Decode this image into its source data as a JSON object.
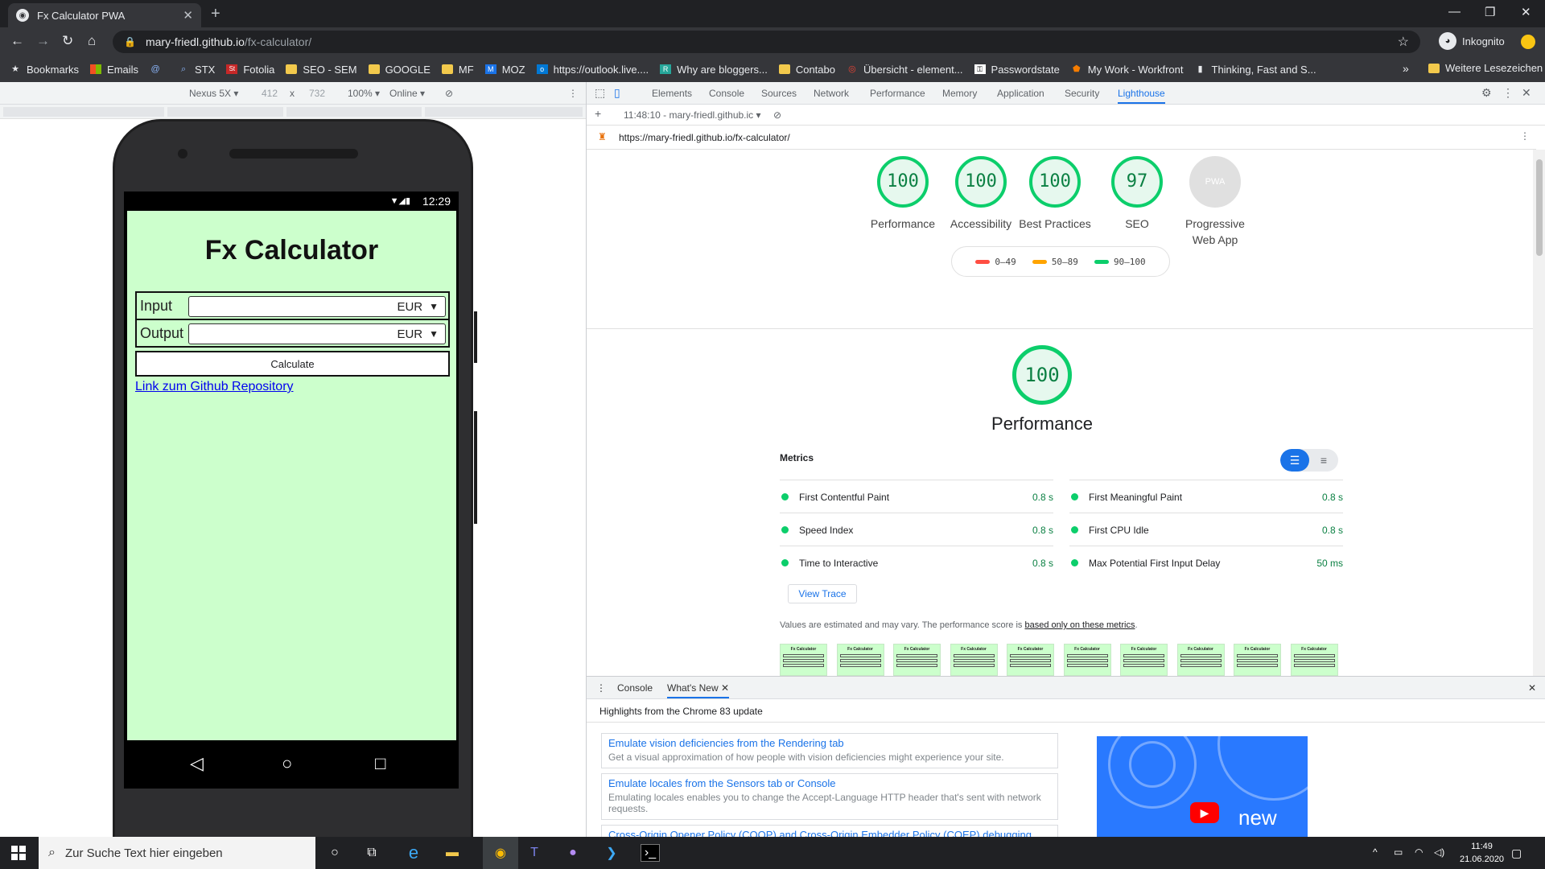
{
  "browser": {
    "tab_title": "Fx Calculator PWA",
    "tab_favicon": "globe-icon",
    "url_host": "mary-friedl.github.io",
    "url_path": "/fx-calculator/",
    "profile": "Inkognito"
  },
  "bookmarks": {
    "items": [
      "Bookmarks",
      "Emails",
      "",
      "STX",
      "Fotolia",
      "SEO - SEM",
      "GOOGLE",
      "MF",
      "MOZ",
      "https://outlook.live....",
      "Why are bloggers...",
      "Contabo",
      "Übersicht - element...",
      "Passwordstate",
      "My Work - Workfront",
      "Thinking, Fast and S..."
    ],
    "more": "»",
    "other": "Weitere Lesezeichen"
  },
  "device_toolbar": {
    "device": "Nexus 5X ▾",
    "width": "412",
    "x": "x",
    "height": "732",
    "zoom": "100% ▾",
    "network": "Online ▾"
  },
  "phone": {
    "time": "12:29",
    "app_title": "Fx Calculator",
    "input_label": "Input",
    "input_currency": "EUR",
    "output_label": "Output",
    "output_currency": "EUR",
    "calculate": "Calculate",
    "link": "Link zum Github Repository"
  },
  "devtools": {
    "tabs": [
      "Elements",
      "Console",
      "Sources",
      "Network",
      "Performance",
      "Memory",
      "Application",
      "Security",
      "Lighthouse"
    ],
    "active_tab": "Lighthouse",
    "report_select": "11:48:10 - mary-friedl.github.ic ▾",
    "report_url": "https://mary-friedl.github.io/fx-calculator/"
  },
  "lighthouse": {
    "scores": [
      {
        "value": "100",
        "label": "Performance"
      },
      {
        "value": "100",
        "label": "Accessibility"
      },
      {
        "value": "100",
        "label": "Best Practices"
      },
      {
        "value": "97",
        "label": "SEO"
      },
      {
        "value": "PWA",
        "label": "Progressive Web App"
      }
    ],
    "legend": [
      "0–49",
      "50–89",
      "90–100"
    ],
    "legend_colors": [
      "#ff4e42",
      "#ffa400",
      "#0cce6b"
    ],
    "perf_score": "100",
    "perf_title": "Performance",
    "metrics_heading": "Metrics",
    "metrics": [
      {
        "name": "First Contentful Paint",
        "value": "0.8 s"
      },
      {
        "name": "First Meaningful Paint",
        "value": "0.8 s"
      },
      {
        "name": "Speed Index",
        "value": "0.8 s"
      },
      {
        "name": "First CPU Idle",
        "value": "0.8 s"
      },
      {
        "name": "Time to Interactive",
        "value": "0.8 s"
      },
      {
        "name": "Max Potential First Input Delay",
        "value": "50 ms"
      }
    ],
    "view_trace": "View Trace",
    "note_prefix": "Values are estimated and may vary. The performance score is ",
    "note_link": "based only on these metrics",
    "note_suffix": ".",
    "thumb_title": "Fx Calculator"
  },
  "drawer": {
    "tab_console": "Console",
    "tab_whatsnew": "What's New",
    "highlights": "Highlights from the Chrome 83 update",
    "cards": [
      {
        "title": "Emulate vision deficiencies from the Rendering tab",
        "desc": "Get a visual approximation of how people with vision deficiencies might experience your site."
      },
      {
        "title": "Emulate locales from the Sensors tab or Console",
        "desc": "Emulating locales enables you to change the Accept-Language HTTP header that's sent with network requests."
      },
      {
        "title": "Cross-Origin Opener Policy (COOP) and Cross-Origin Embedder Policy (COEP) debugging",
        "desc": ""
      }
    ],
    "video_label": "new"
  },
  "taskbar": {
    "search_placeholder": "Zur Suche Text hier eingeben",
    "time": "11:49",
    "date": "21.06.2020"
  }
}
